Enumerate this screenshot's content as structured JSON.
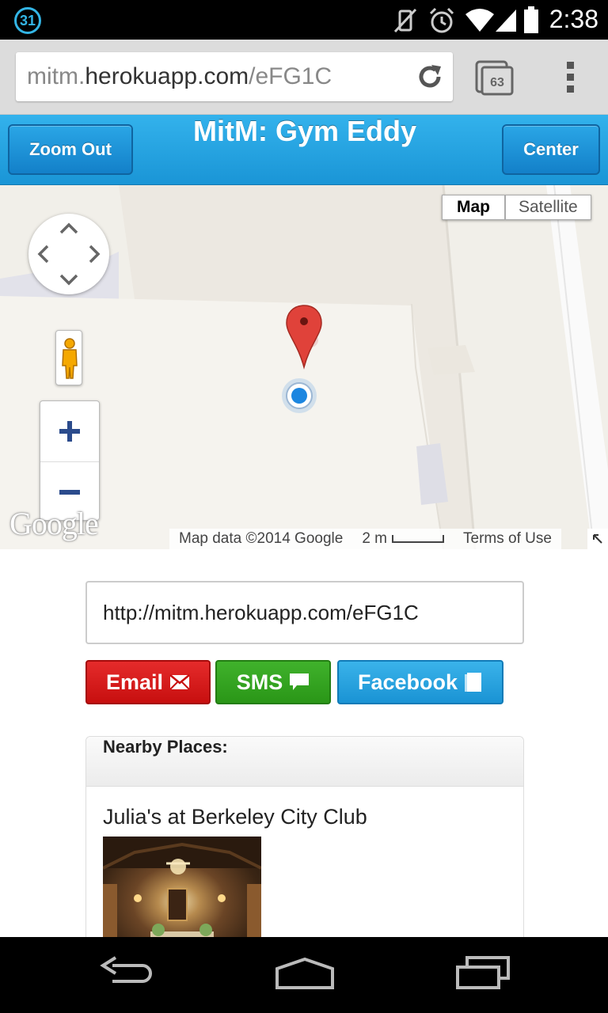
{
  "status_bar": {
    "calendar_day": "31",
    "time": "2:38",
    "icons": [
      "vibrate-off-icon",
      "alarm-icon",
      "wifi-icon",
      "signal-icon",
      "battery-icon"
    ]
  },
  "browser": {
    "url_prefix": "mitm.",
    "url_host": "herokuapp.com",
    "url_path": "/eFG1C",
    "tab_count": "63"
  },
  "header": {
    "title": "MitM: Gym Eddy",
    "zoom_out_label": "Zoom Out",
    "center_label": "Center",
    "color": "#1ea0e0"
  },
  "map": {
    "type_map": "Map",
    "type_satellite": "Satellite",
    "logo": "Google",
    "attribution": "Map data ©2014 Google",
    "scale": "2 m",
    "terms": "Terms of Use",
    "zoom_in": "+",
    "zoom_out": "−"
  },
  "share": {
    "url_value": "http://mitm.herokuapp.com/eFG1C",
    "email_label": "Email",
    "sms_label": "SMS",
    "facebook_label": "Facebook",
    "email_color": "#d41b1b",
    "sms_color": "#35a522",
    "facebook_color": "#2aa4e0"
  },
  "nearby": {
    "heading": "Nearby Places:",
    "places": [
      {
        "name": "Julia's at Berkeley City Club"
      }
    ]
  }
}
